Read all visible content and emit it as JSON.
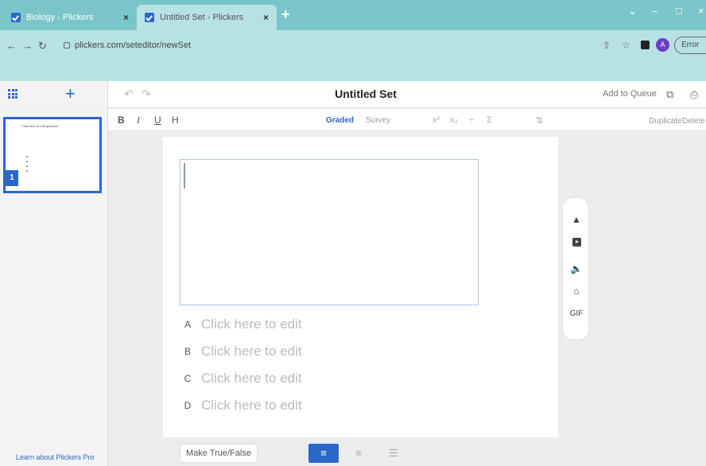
{
  "browser": {
    "tabs": [
      {
        "label": "Biology - Plickers",
        "active": false
      },
      {
        "label": "Untitled Set - Plickers",
        "active": true
      }
    ],
    "new_tab_glyph": "+",
    "close_glyph": "×",
    "url": "plickers.com/seteditor/newSet",
    "profile_initial": "A",
    "update_label": "Error"
  },
  "app": {
    "set_title": "Untitled Set",
    "add_to_queue": "Add to Queue",
    "add_glyph": "+",
    "toolbar": {
      "bold": "B",
      "italic": "I",
      "underline": "U",
      "heading": "H",
      "graded": "Graded",
      "survey": "Survey",
      "duplicate": "Duplicate",
      "delete": "Delete"
    },
    "sidebar": {
      "slide_number": "1",
      "slide_preview_text": "Click here to edit question",
      "learn_pro": "Learn about Plickers Pro"
    },
    "choices": [
      {
        "letter": "A",
        "text": "Click here to edit"
      },
      {
        "letter": "B",
        "text": "Click here to edit"
      },
      {
        "letter": "C",
        "text": "Click here to edit"
      },
      {
        "letter": "D",
        "text": "Click here to edit"
      }
    ],
    "media": {
      "gif": "GIF"
    },
    "bottom": {
      "make_true_false": "Make True/False"
    }
  },
  "colors": {
    "accent": "#2b67c9",
    "chrome": "#7ac5c9",
    "chrome_light": "#b7e2e3"
  }
}
